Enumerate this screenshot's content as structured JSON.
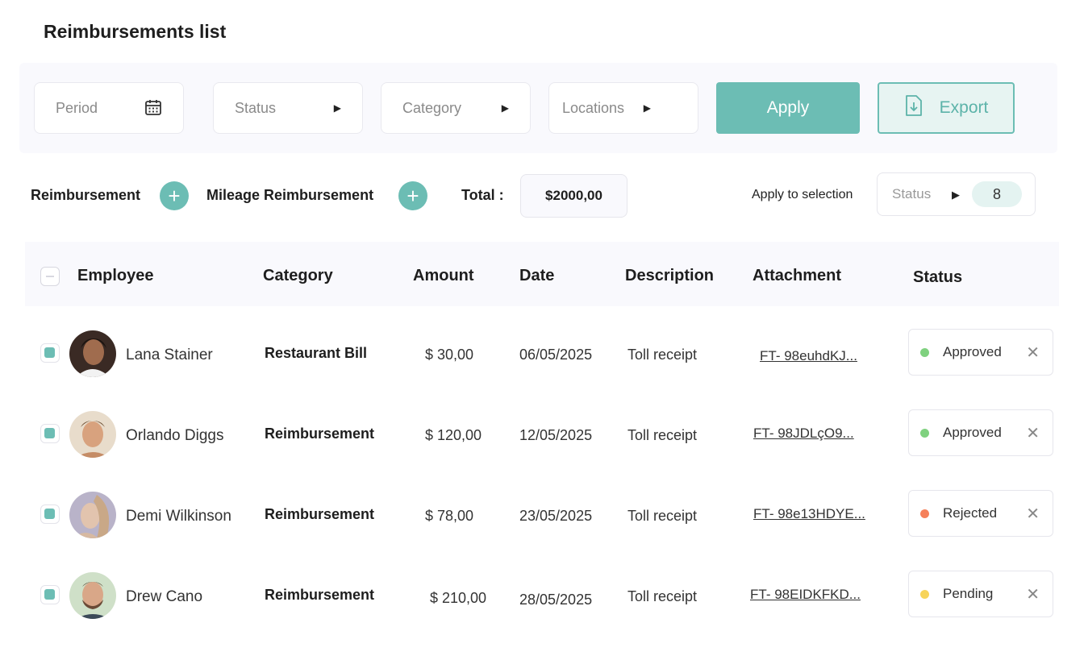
{
  "page": {
    "title": "Reimbursements list"
  },
  "filters": {
    "period": "Period",
    "status": "Status",
    "category": "Category",
    "locations": "Locations",
    "apply": "Apply",
    "export": "Export"
  },
  "actions": {
    "reimbursement": "Reimbursement",
    "mileage": "Mileage Reimbursement",
    "total_label": "Total :",
    "total_value": "$2000,00",
    "apply_to_selection": "Apply to selection",
    "selection_status": "Status",
    "selection_count": "8"
  },
  "table": {
    "headers": {
      "employee": "Employee",
      "category": "Category",
      "amount": "Amount",
      "date": "Date",
      "description": "Description",
      "attachment": "Attachment",
      "status": "Status"
    },
    "rows": [
      {
        "name": "Lana Stainer",
        "category": "Restaurant Bill",
        "amount": "$ 30,00",
        "date": "06/05/2025",
        "description": "Toll receipt",
        "attachment": "FT- 98euhdKJ...",
        "status": "Approved",
        "status_color": "#7fd17f"
      },
      {
        "name": "Orlando Diggs",
        "category": "Reimbursement",
        "amount": "$ 120,00",
        "date": "12/05/2025",
        "description": "Toll receipt",
        "attachment": "FT- 98JDLçO9...",
        "status": "Approved",
        "status_color": "#7fd17f"
      },
      {
        "name": "Demi Wilkinson",
        "category": "Reimbursement",
        "amount": "$ 78,00",
        "date": "23/05/2025",
        "description": "Toll receipt",
        "attachment": "FT- 98e13HDYE...",
        "status": "Rejected",
        "status_color": "#f5805a"
      },
      {
        "name": "Drew Cano",
        "category": "Reimbursement",
        "amount": "$ 210,00",
        "date": "28/05/2025",
        "description": "Toll receipt",
        "attachment": "FT- 98EIDKFKD...",
        "status": "Pending",
        "status_color": "#f7d45a"
      }
    ]
  },
  "colors": {
    "accent": "#6cbdb4",
    "accent_light": "#e7f4f2"
  },
  "icons": {
    "period": "calendar-icon",
    "dropdown": "caret-right-icon",
    "export": "download-file-icon",
    "add": "plus-icon",
    "remove": "close-icon"
  }
}
